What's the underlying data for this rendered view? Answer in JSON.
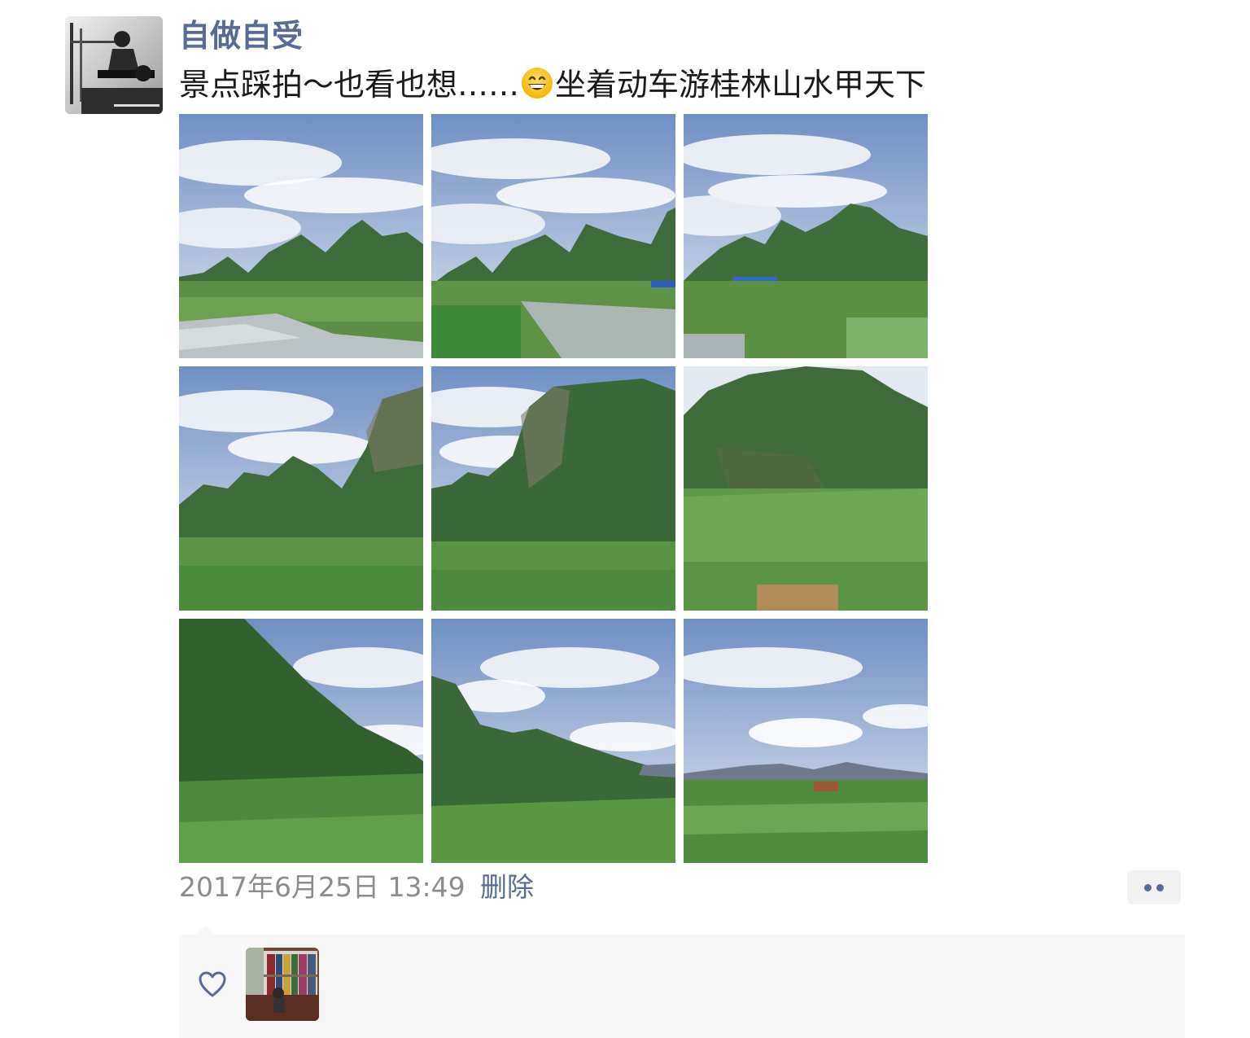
{
  "post": {
    "author": "自做自受",
    "text_before_emoji": "景点踩拍～也看也想……",
    "emoji": "grinning-face-emoji",
    "text_after_emoji": "坐着动车游桂林山水甲天下",
    "photos": [
      {
        "name": "photo-1"
      },
      {
        "name": "photo-2"
      },
      {
        "name": "photo-3"
      },
      {
        "name": "photo-4"
      },
      {
        "name": "photo-5"
      },
      {
        "name": "photo-6"
      },
      {
        "name": "photo-7"
      },
      {
        "name": "photo-8"
      },
      {
        "name": "photo-9"
      }
    ],
    "timestamp": "2017年6月25日 13:49",
    "delete_label": "删除",
    "more_icon": "more-dots-icon"
  },
  "likes": {
    "icon": "heart-icon",
    "likers": [
      {
        "name": "liker-avatar"
      }
    ]
  },
  "colors": {
    "link": "#576b95",
    "text": "#1a1a1a",
    "meta": "#8c8c8c",
    "panel_bg": "#f7f7f7"
  }
}
